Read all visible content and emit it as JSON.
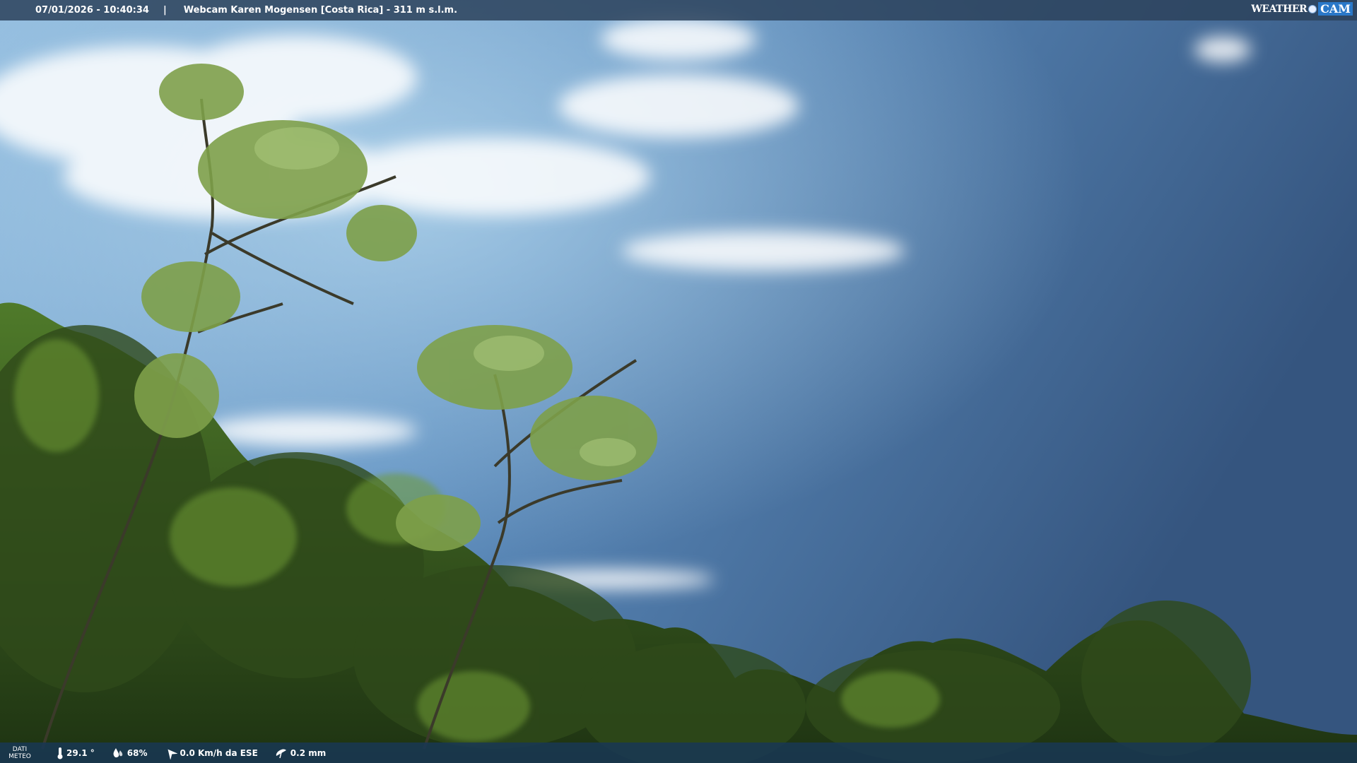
{
  "header": {
    "timestamp": "07/01/2026 - 10:40:34",
    "separator": "|",
    "title": "Webcam Karen Mogensen [Costa Rica]  - 311 m s.l.m."
  },
  "brand": {
    "weather": "WEATHER",
    "cam": "CAM"
  },
  "footer": {
    "dati_line1": "DATI",
    "dati_line2": "METEO",
    "temperature": "29.1 °",
    "humidity": "68%",
    "wind": "0.0 Km/h da ESE",
    "rain": "0.2 mm"
  },
  "colors": {
    "sky_top": "#9fc4e0",
    "sky_bottom": "#3f6a9a",
    "foliage": "#3f5c22",
    "bar": "#2c425c"
  }
}
